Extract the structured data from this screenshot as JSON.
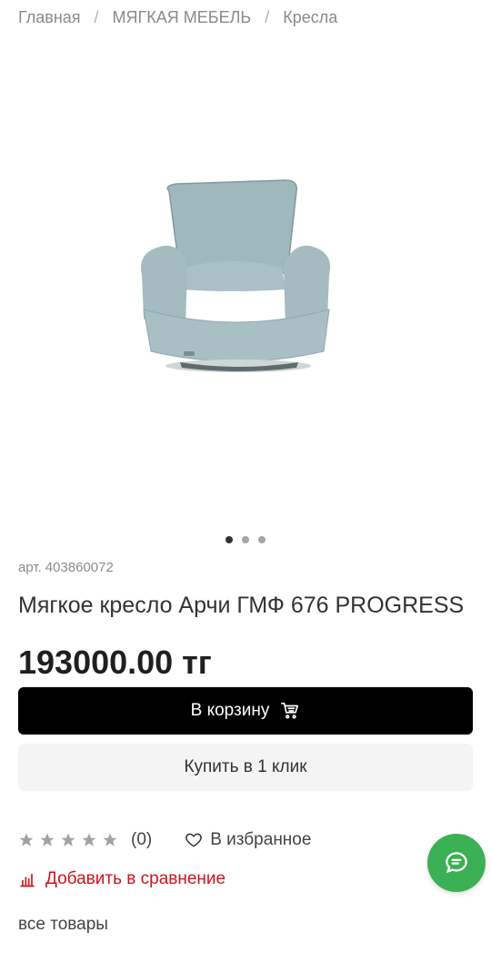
{
  "breadcrumb": {
    "items": [
      "Главная",
      "МЯГКАЯ МЕБЕЛЬ",
      "Кресла"
    ],
    "separator": "/"
  },
  "gallery": {
    "image_icon": "armchair-image",
    "dots": {
      "total": 3,
      "active_index": 0
    }
  },
  "product": {
    "sku_label": "арт.",
    "sku": "403860072",
    "title": "Мягкое кресло Арчи ГМФ 676 PROGRESS",
    "price": "193000.00 тг"
  },
  "actions": {
    "cart_label": "В корзину",
    "cart_icon": "cart-icon",
    "one_click_label": "Купить в 1 клик"
  },
  "rating": {
    "stars": 5,
    "filled": 0,
    "count": "(0)",
    "star_color": "#a3a3a3"
  },
  "favorites": {
    "label": "В избранное",
    "icon": "heart-icon"
  },
  "compare": {
    "label": "Добавить в сравнение",
    "icon": "chart-icon",
    "color": "#d2121e"
  },
  "all_goods_label": "все товары",
  "chat": {
    "icon": "chat-icon",
    "color": "#3cb054"
  }
}
